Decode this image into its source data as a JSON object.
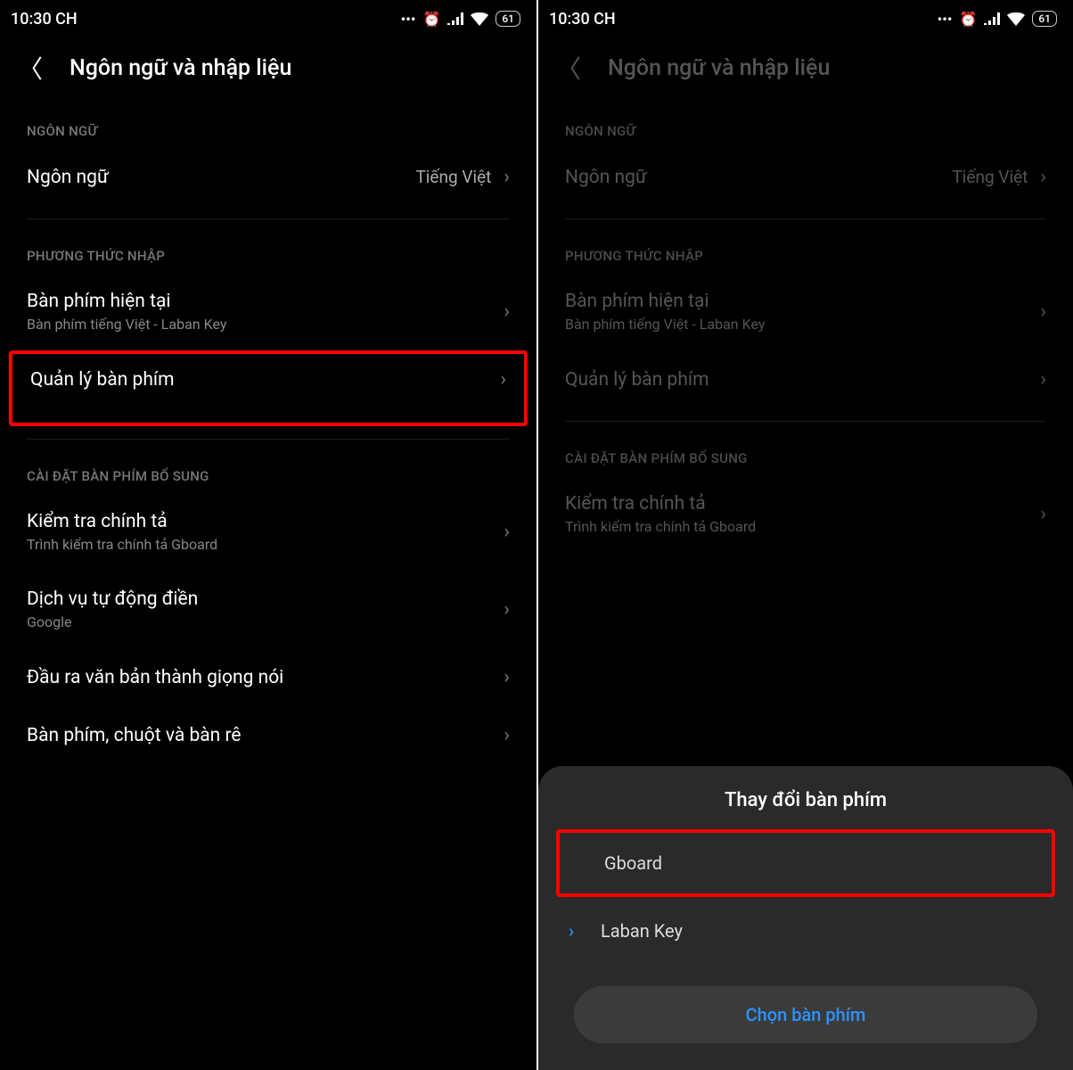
{
  "status": {
    "time": "10:30 CH",
    "battery": "61"
  },
  "header": {
    "title": "Ngôn ngữ và nhập liệu"
  },
  "section1": {
    "label": "NGÔN NGỮ"
  },
  "language_row": {
    "label": "Ngôn ngữ",
    "value": "Tiếng Việt"
  },
  "section2": {
    "label": "PHƯƠNG THỨC NHẬP"
  },
  "current_kb": {
    "label": "Bàn phím hiện tại",
    "sub": "Bàn phím tiếng Việt - Laban Key"
  },
  "manage_kb": {
    "label": "Quản lý bàn phím"
  },
  "section3": {
    "label": "CÀI ĐẶT BÀN PHÍM BỔ SUNG"
  },
  "spell": {
    "label": "Kiểm tra chính tả",
    "sub": "Trình kiểm tra chính tả Gboard"
  },
  "autofill": {
    "label": "Dịch vụ tự động điền",
    "sub": "Google"
  },
  "tts": {
    "label": "Đầu ra văn bản thành giọng nói"
  },
  "pointer": {
    "label": "Bàn phím, chuột và bàn rê"
  },
  "sheet": {
    "title": "Thay đổi bàn phím",
    "opt1": "Gboard",
    "opt2": "Laban Key",
    "action": "Chọn bàn phím"
  }
}
